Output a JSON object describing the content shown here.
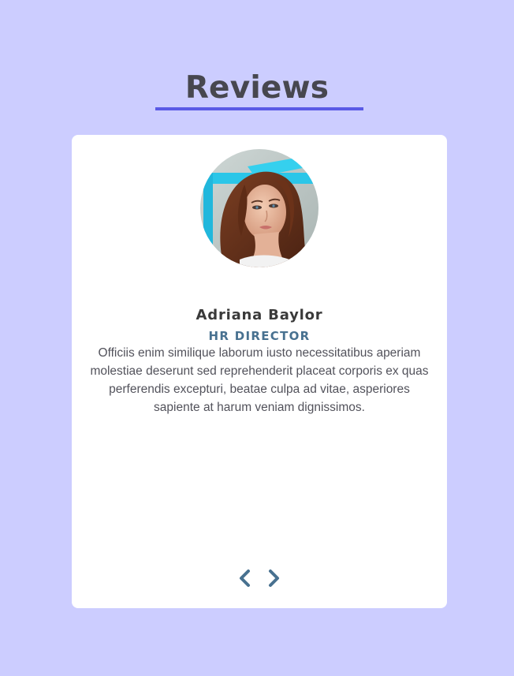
{
  "page": {
    "title": "Reviews"
  },
  "review": {
    "name": "Adriana Baylor",
    "job": "HR DIRECTOR",
    "text": "Officiis enim similique laborum iusto necessitatibus aperiam molestiae deserunt sed reprehenderit placeat corporis ex quas perferendis excepturi, beatae culpa ad vitae, asperiores sapiente at harum veniam dignissimos."
  },
  "controls": {
    "prev_icon": "chevron-left-icon",
    "next_icon": "chevron-right-icon"
  },
  "colors": {
    "background": "#cccdff",
    "accent": "#5a5ae6",
    "title": "#47474f",
    "job": "#487190",
    "chevron": "#487190"
  }
}
